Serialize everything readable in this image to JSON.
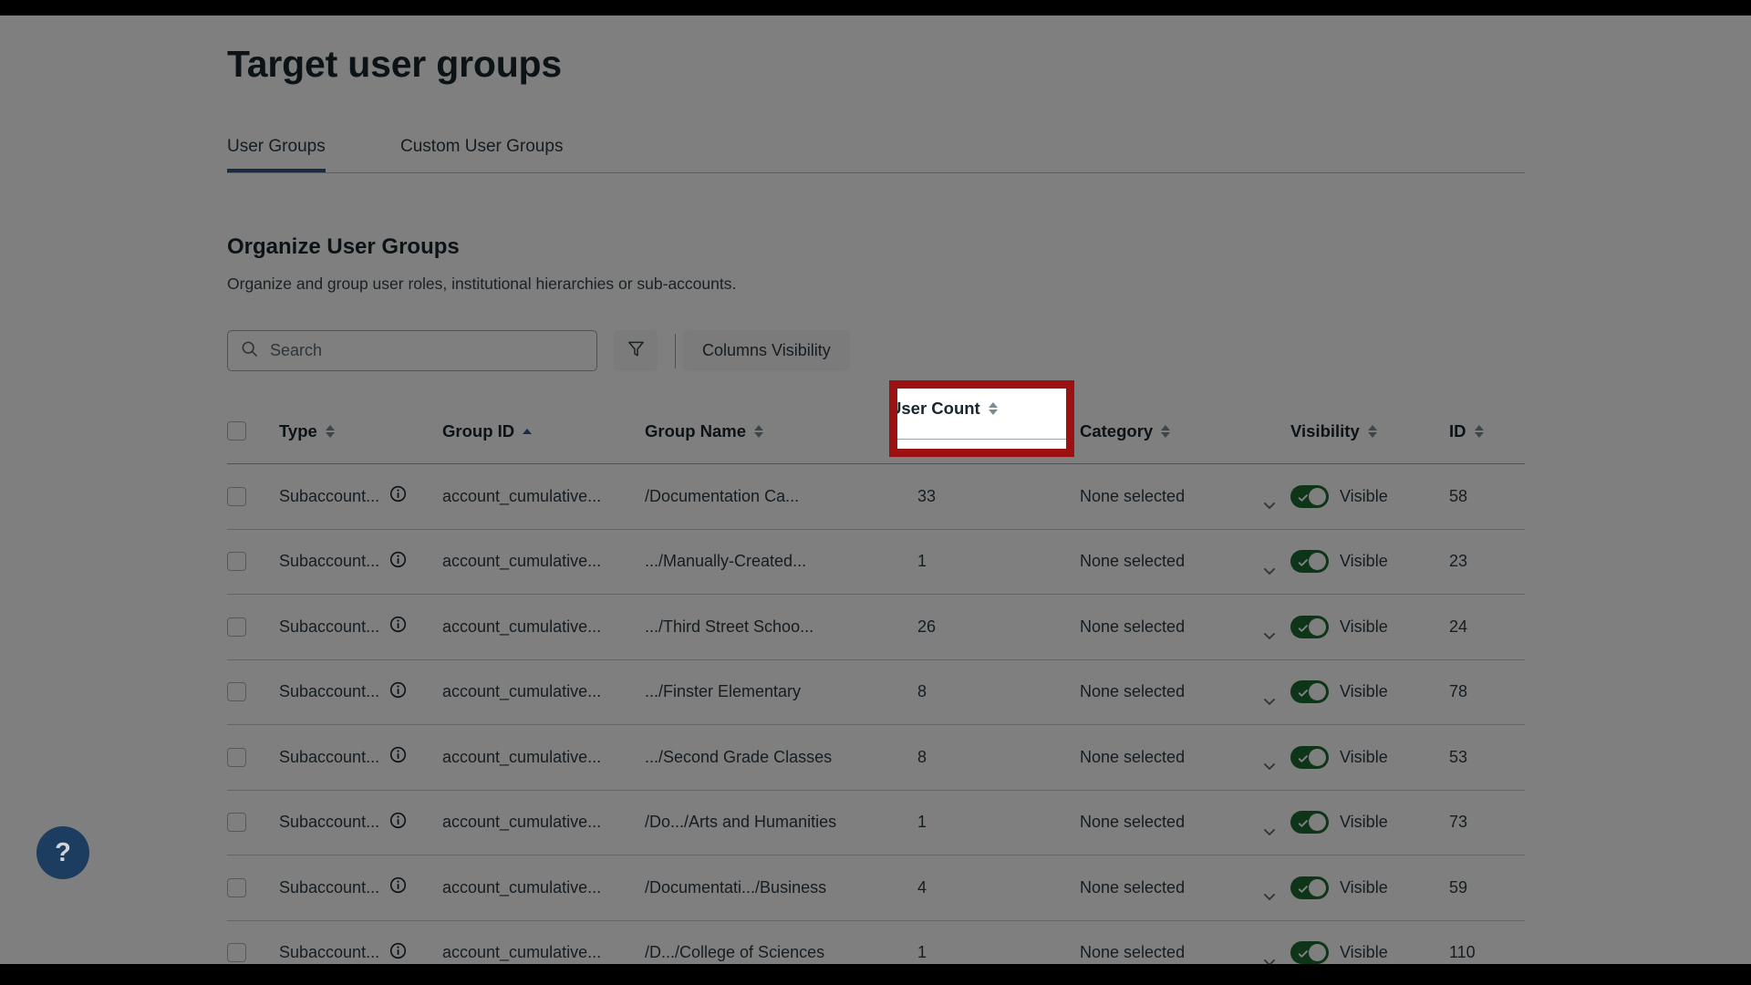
{
  "page": {
    "title": "Target user groups"
  },
  "tabs": [
    {
      "label": "User Groups",
      "active": true
    },
    {
      "label": "Custom User Groups",
      "active": false
    }
  ],
  "section": {
    "title": "Organize User Groups",
    "subtitle": "Organize and group user roles, institutional hierarchies or sub-accounts."
  },
  "toolbar": {
    "search_placeholder": "Search",
    "search_value": "",
    "search_icon": "search-icon",
    "filter_icon": "filter-funnel-icon",
    "columns_visibility_label": "Columns Visibility"
  },
  "table": {
    "columns": [
      {
        "key": "select",
        "label": "",
        "sort": "none"
      },
      {
        "key": "type",
        "label": "Type",
        "sort": "none"
      },
      {
        "key": "group_id",
        "label": "Group ID",
        "sort": "asc"
      },
      {
        "key": "group_name",
        "label": "Group Name",
        "sort": "none"
      },
      {
        "key": "user_count",
        "label": "User Count",
        "sort": "none"
      },
      {
        "key": "category",
        "label": "Category",
        "sort": "none"
      },
      {
        "key": "visibility",
        "label": "Visibility",
        "sort": "none"
      },
      {
        "key": "id",
        "label": "ID",
        "sort": "none"
      }
    ],
    "rows": [
      {
        "type": "Subaccount...",
        "group_id": "account_cumulative...",
        "group_name": "/Documentation Ca...",
        "user_count": "33",
        "category": "None selected",
        "visibility": "Visible",
        "visibility_on": true,
        "id": "58"
      },
      {
        "type": "Subaccount...",
        "group_id": "account_cumulative...",
        "group_name": ".../Manually-Created...",
        "user_count": "1",
        "category": "None selected",
        "visibility": "Visible",
        "visibility_on": true,
        "id": "23"
      },
      {
        "type": "Subaccount...",
        "group_id": "account_cumulative...",
        "group_name": ".../Third Street Schoo...",
        "user_count": "26",
        "category": "None selected",
        "visibility": "Visible",
        "visibility_on": true,
        "id": "24"
      },
      {
        "type": "Subaccount...",
        "group_id": "account_cumulative...",
        "group_name": ".../Finster Elementary",
        "user_count": "8",
        "category": "None selected",
        "visibility": "Visible",
        "visibility_on": true,
        "id": "78"
      },
      {
        "type": "Subaccount...",
        "group_id": "account_cumulative...",
        "group_name": ".../Second Grade Classes",
        "user_count": "8",
        "category": "None selected",
        "visibility": "Visible",
        "visibility_on": true,
        "id": "53"
      },
      {
        "type": "Subaccount...",
        "group_id": "account_cumulative...",
        "group_name": "/Do.../Arts and Humanities",
        "user_count": "1",
        "category": "None selected",
        "visibility": "Visible",
        "visibility_on": true,
        "id": "73"
      },
      {
        "type": "Subaccount...",
        "group_id": "account_cumulative...",
        "group_name": "/Documentati.../Business",
        "user_count": "4",
        "category": "None selected",
        "visibility": "Visible",
        "visibility_on": true,
        "id": "59"
      },
      {
        "type": "Subaccount...",
        "group_id": "account_cumulative...",
        "group_name": "/D.../College of Sciences",
        "user_count": "1",
        "category": "None selected",
        "visibility": "Visible",
        "visibility_on": true,
        "id": "110"
      }
    ]
  },
  "help_button": {
    "icon": "question-mark-icon",
    "label": "?"
  },
  "annotation": {
    "target_label": "User Count",
    "box_color": "#9c1111"
  },
  "colors": {
    "accent": "#34557e",
    "toggle_on": "#1d6b2e",
    "text": "#17272f",
    "sort_active": "#2f5a91",
    "help_fab": "#1c3d5f"
  }
}
